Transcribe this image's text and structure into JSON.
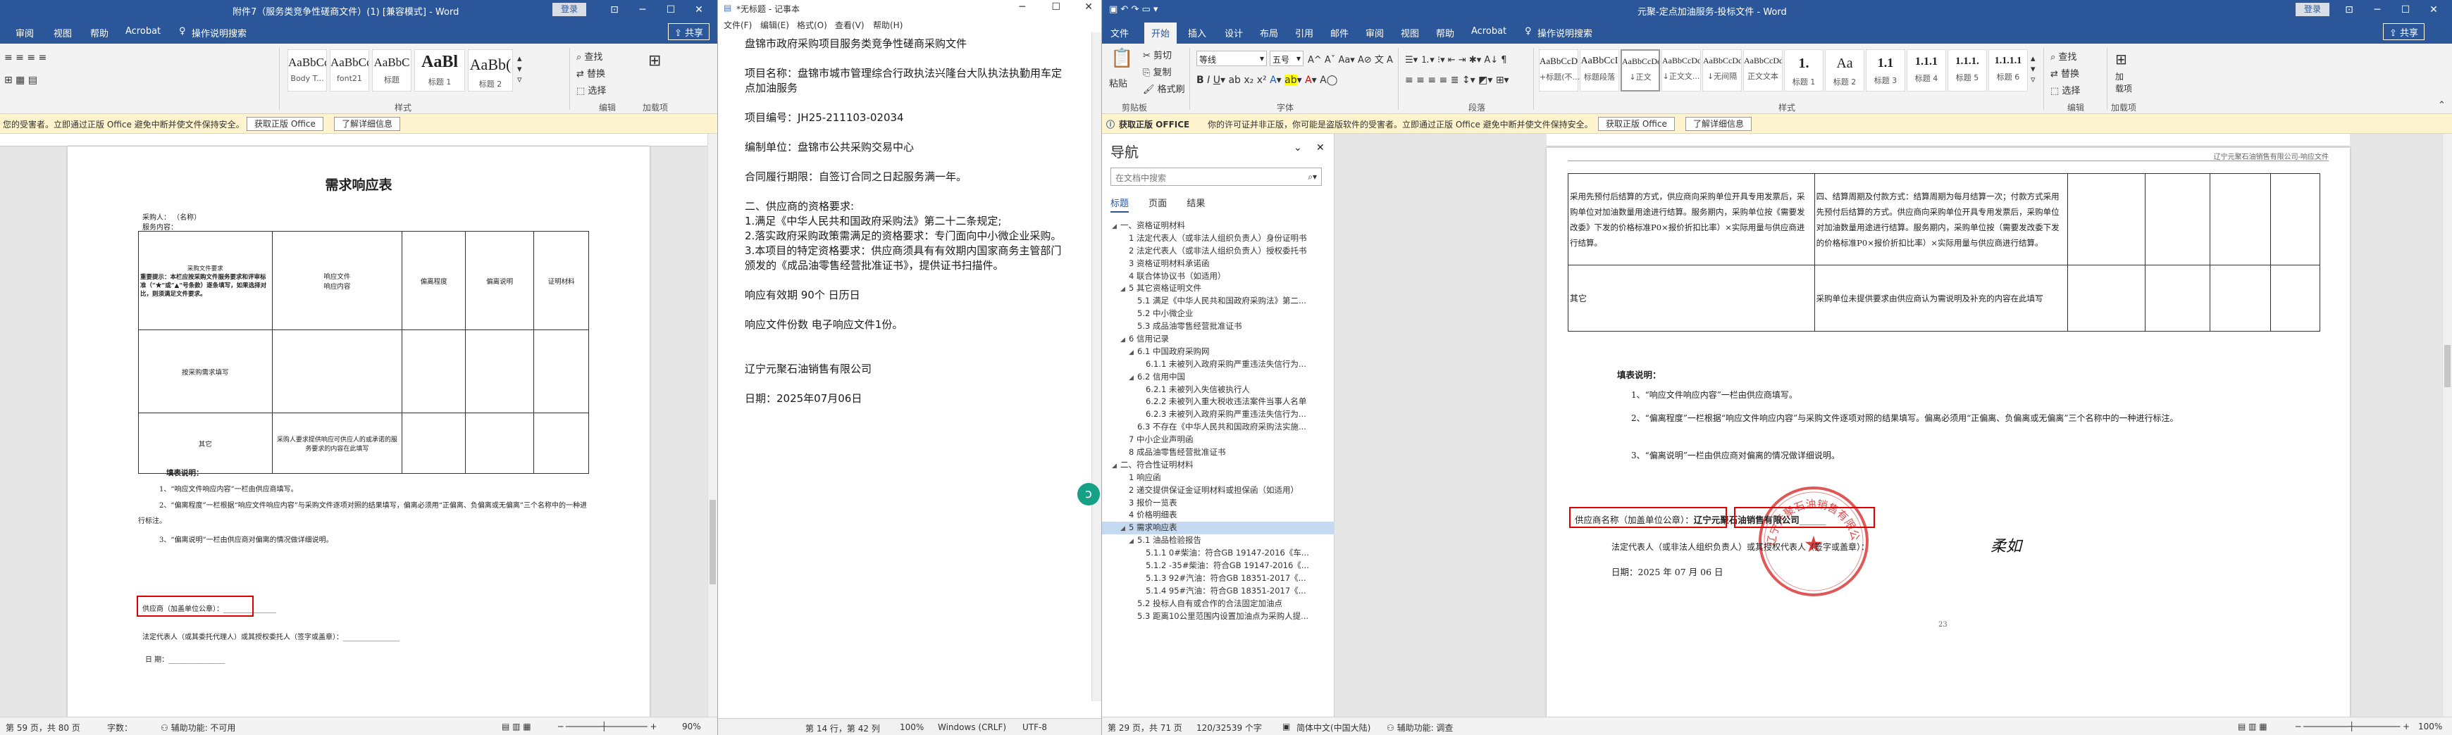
{
  "left_word": {
    "title": "附件7（服务类竞争性磋商文件）(1) [兼容模式] - Word",
    "login": "登录",
    "menu": [
      "审阅",
      "视图",
      "帮助",
      "Acrobat",
      "操作说明搜索"
    ],
    "share": "共享",
    "styles": [
      {
        "preview": "AaBbCcDc",
        "name": "Body T..."
      },
      {
        "preview": "AaBbCcDc",
        "name": "font21"
      },
      {
        "preview": "AaBbC",
        "name": "标题"
      },
      {
        "preview": "AaBl",
        "name": "标题 1"
      },
      {
        "preview": "AaBb(",
        "name": "标题 2"
      }
    ],
    "editing": [
      "查找",
      "替换",
      "选择"
    ],
    "group_labels": {
      "style": "样式",
      "editing": "编辑",
      "addin": "加载项"
    },
    "notif": {
      "text": "您的受害者。立即通过正版 Office 避免中断并使文件保持安全。",
      "btn1": "获取正版 Office",
      "btn2": "了解详细信息"
    },
    "doc": {
      "heading": "需求响应表",
      "supplier_line": "采购人：   （名称）",
      "project_line": "服务内容：",
      "col1": "采购文件要求",
      "col1_note": "重要提示：本栏应按采购文件服务要求和评审标准（“★”或“▲”号条款）逐条填写，如果选择对比，则须满足文件要求。",
      "col2": "响应文件\n响应内容",
      "col3": "偏离程度",
      "col4": "偏离说明",
      "col5": "证明材料",
      "row2_col1": "按采购需求填写",
      "row3_col1": "其它",
      "row3_col2": "采购人要求提供响应可供应人的或承诺的服务要求的内容在此填写",
      "notes_title": "填表说明：",
      "notes": [
        "1、“响应文件响应内容”一栏由供应商填写。",
        "2、“偏离程度”一栏根据“响应文件响应内容”与采购文件逐项对照的结果填写，偏离必须用“正偏离、负偏离或无偏离”三个名称中的一种进行标注。",
        "3、“偏离说明”一栏由供应商对偏离的情况做详细说明。"
      ],
      "supplier_sign": "供应商（加盖单位公章）：",
      "rep_sign": "法定代表人（或其委托代理人）或其授权委托人（签字或盖章）：",
      "date_line": "日      期："
    },
    "status": {
      "page": "第 59 页，共 80 页",
      "words": "字数：",
      "access": "辅助功能: 不可用",
      "zoom": "90%"
    }
  },
  "notepad": {
    "title": "*无标题 - 记事本",
    "menu": [
      "文件(F)",
      "编辑(E)",
      "格式(O)",
      "查看(V)",
      "帮助(H)"
    ],
    "lines": [
      "盘锦市政府采购项目服务类竞争性磋商采购文件",
      "",
      "项目名称：盘锦市城市管理综合行政执法兴隆台大队执法执勤用车定",
      "点加油服务",
      "",
      "项目编号：JH25-211103-02034",
      "",
      "编制单位：盘锦市公共采购交易中心",
      "",
      "合同履行期限：自签订合同之日起服务满一年。",
      "",
      "二、供应商的资格要求:",
      "1.满足《中华人民共和国政府采购法》第二十二条规定;",
      "2.落实政府采购政策需满足的资格要求：专门面向中小微企业采购。",
      "3.本项目的特定资格要求：供应商须具有有效期内国家商务主管部门",
      "颁发的《成品油零售经营批准证书》，提供证书扫描件。",
      "",
      "响应有效期         90个  日历日",
      "",
      "响应文件份数         电子响应文件1份。",
      "",
      "",
      "辽宁元聚石油销售有限公司",
      "",
      "日期：2025年07月06日"
    ],
    "status": {
      "pos": "第 14 行，第 42 列",
      "zoom": "100%",
      "eol": "Windows (CRLF)",
      "enc": "UTF-8"
    }
  },
  "right_word": {
    "title": "元聚-定点加油服务-投标文件 - Word",
    "login": "登录",
    "menu": [
      "文件",
      "开始",
      "插入",
      "设计",
      "布局",
      "引用",
      "邮件",
      "审阅",
      "视图",
      "帮助",
      "Acrobat",
      "操作说明搜索"
    ],
    "share": "共享",
    "clipboard": {
      "paste": "粘贴",
      "cut": "剪切",
      "copy": "复制",
      "painter": "格式刷"
    },
    "font_name": "等线",
    "font_size": "五号",
    "styles": [
      {
        "preview": "AaBbCcDc",
        "name": "+标题(不..."
      },
      {
        "preview": "AaBbCcI",
        "name": "标题段落"
      },
      {
        "preview": "AaBbCcDd",
        "name": "↓正文"
      },
      {
        "preview": "AaBbCcDd",
        "name": "↓正文文..."
      },
      {
        "preview": "AaBbCcDd",
        "name": "↓无间隔"
      },
      {
        "preview": "AaBbCcDd",
        "name": "正文文本"
      },
      {
        "preview": "1.",
        "name": "标题 1"
      },
      {
        "preview": "Aa",
        "name": "标题 2"
      },
      {
        "preview": "1.1",
        "name": "标题 3"
      },
      {
        "preview": "1.1.1",
        "name": "标题 4"
      },
      {
        "preview": "1.1.1.",
        "name": "标题 5"
      },
      {
        "preview": "1.1.1.1",
        "name": "标题 6"
      }
    ],
    "editing": [
      "查找",
      "替换",
      "选择"
    ],
    "group_labels": {
      "clipboard": "剪贴板",
      "font": "字体",
      "paragraph": "段落",
      "style": "样式",
      "editing": "编辑",
      "addin": "加载项"
    },
    "addin": "加\n载项",
    "notif": {
      "label": "获取正版 OFFICE",
      "text": "你的许可证并非正版，你可能是盗版软件的受害者。立即通过正版 Office 避免中断并使文件保持安全。",
      "btn1": "获取正版 Office",
      "btn2": "了解详细信息"
    },
    "nav": {
      "title": "导航",
      "search": "在文档中搜索",
      "tabs": [
        "标题",
        "页面",
        "结果"
      ],
      "items": [
        {
          "t": "一、资格证明材料",
          "l": 0,
          "e": "open"
        },
        {
          "t": "1 法定代表人（或非法人组织负责人）身份证明书",
          "l": 1
        },
        {
          "t": "2 法定代表人（或非法人组织负责人）授权委托书",
          "l": 1
        },
        {
          "t": "3 资格证明材料承诺函",
          "l": 1
        },
        {
          "t": "4 联合体协议书（如适用）",
          "l": 1
        },
        {
          "t": "5 其它资格证明文件",
          "l": 1,
          "e": "open"
        },
        {
          "t": "5.1 满足《中华人民共和国政府采购法》第二...",
          "l": 2
        },
        {
          "t": "5.2 中小微企业",
          "l": 2
        },
        {
          "t": "5.3 成品油零售经营批准证书",
          "l": 2
        },
        {
          "t": "6 信用记录",
          "l": 1,
          "e": "open"
        },
        {
          "t": "6.1 中国政府采购网",
          "l": 2,
          "e": "open"
        },
        {
          "t": "6.1.1 未被列入政府采购严重违法失信行为...",
          "l": 3
        },
        {
          "t": "6.2 信用中国",
          "l": 2,
          "e": "open"
        },
        {
          "t": "6.2.1 未被列入失信被执行人",
          "l": 3
        },
        {
          "t": "6.2.2 未被列入重大税收违法案件当事人名单",
          "l": 3
        },
        {
          "t": "6.2.3 未被列入政府采购严重违法失信行为...",
          "l": 3
        },
        {
          "t": "6.3 不存在《中华人民共和国政府采购法实施...",
          "l": 2
        },
        {
          "t": "7 中小企业声明函",
          "l": 1
        },
        {
          "t": "8 成品油零售经营批准证书",
          "l": 1
        },
        {
          "t": "二、符合性证明材料",
          "l": 0,
          "e": "open"
        },
        {
          "t": "1 响应函",
          "l": 1
        },
        {
          "t": "2 递交提供保证金证明材料或担保函（如适用）",
          "l": 1
        },
        {
          "t": "3 报价一览表",
          "l": 1
        },
        {
          "t": "4 价格明细表",
          "l": 1
        },
        {
          "t": "5 需求响应表",
          "l": 1,
          "e": "open",
          "sel": true
        },
        {
          "t": "5.1 油品检验报告",
          "l": 2,
          "e": "open"
        },
        {
          "t": "5.1.1 0#柴油：符合GB 19147-2016《车...",
          "l": 3
        },
        {
          "t": "5.1.2 -35#柴油：符合GB 19147-2016《...",
          "l": 3
        },
        {
          "t": "5.1.3 92#汽油：符合GB 18351-2017《...",
          "l": 3
        },
        {
          "t": "5.1.4 95#汽油：符合GB 18351-2017《...",
          "l": 3
        },
        {
          "t": "5.2 投标人自有或合作的合法固定加油点",
          "l": 2
        },
        {
          "t": "5.3 距离10公里范围内设置加油点为采购人提...",
          "l": 2
        }
      ]
    },
    "doc": {
      "header_text": "辽宁元聚石油销售有限公司-响应文件",
      "cell_a": "采用先预付后结算的方式，供应商向采购单位开具专用发票后，采购单位对加油数量用途进行结算。服务期内，采购单位按《需要发改委》下发的价格标准P0×报价折扣比率）×实际用量与供应商进行结算。",
      "cell_b": "四、结算周期及付款方式：结算周期为每月结算一次；付款方式采用先预付后结算的方式。供应商向采购单位开具专用发票后，采购单位对加油数量用途进行结算。服务期内，采购单位按（需要发改委下发的价格标准P0×报价折扣比率）×实际用量与供应商进行结算。",
      "row2_left": "其它",
      "row2_mid": "采购单位未提供要求由供应商认为需说明及补充的内容在此填写",
      "notes_title": "填表说明：",
      "notes": [
        "1、“响应文件响应内容”一栏由供应商填写。",
        "2、“偏离程度”一栏根据“响应文件响应内容”与采购文件逐项对照的结果填写。偏离必须用“正偏离、负偏离或无偏离”三个名称中的一种进行标注。",
        "3、“偏离说明”一栏由供应商对偏离的情况做详细说明。"
      ],
      "supplier_label": "供应商名称（加盖单位公章）",
      "supplier_value": "辽宁元聚石油销售有限公司",
      "rep_line": "法定代表人（或非法人组织负责人）或其授权代表人（签字或盖章）：",
      "signature": "柔如",
      "date_line": "日期：2025 年 07 月 06 日",
      "seal_text": "辽宁元聚石油销售有限公司",
      "page_num": "23"
    },
    "status": {
      "page": "第 29 页，共 71 页",
      "words": "120/32539 个字",
      "lang": "简体中文(中国大陆)",
      "access": "辅助功能: 调查",
      "zoom": "100%"
    }
  },
  "colors": {
    "word_blue": "#2b579a",
    "notice_bg": "#fff4ce",
    "red_box": "#e00000",
    "seal_red": "#d42020",
    "nav_sel": "#c5d9f1"
  }
}
